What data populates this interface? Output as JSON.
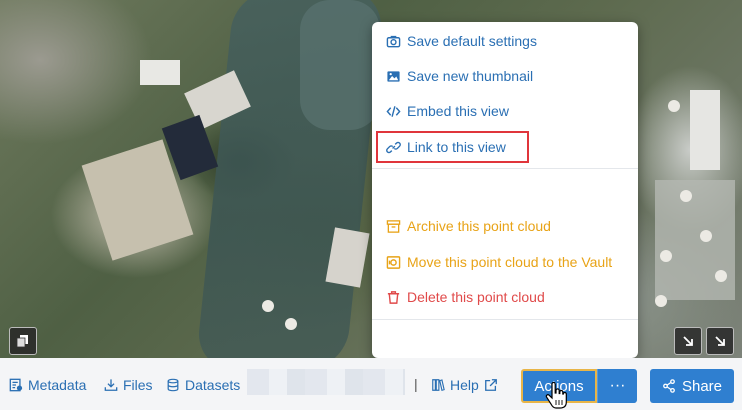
{
  "menu": {
    "items": [
      {
        "label": "Save default settings",
        "icon": "camera-icon",
        "color": "#2a6fb3"
      },
      {
        "label": "Save new thumbnail",
        "icon": "image-icon",
        "color": "#2a6fb3"
      },
      {
        "label": "Embed this view",
        "icon": "code-icon",
        "color": "#2a6fb3"
      },
      {
        "label": "Link to this view",
        "icon": "link-icon",
        "color": "#2a6fb3"
      },
      {
        "label": "Archive this point cloud",
        "icon": "archive-icon",
        "color": "#e8a317"
      },
      {
        "label": "Move this point cloud to the Vault",
        "icon": "vault-icon",
        "color": "#e8a317"
      },
      {
        "label": "Delete this point cloud",
        "icon": "trash-icon",
        "color": "#e04a4a"
      }
    ],
    "highlight_color": "#e0353b"
  },
  "bottom_bar": {
    "metadata": "Metadata",
    "files": "Files",
    "datasets": "Datasets",
    "separator": "|",
    "help": "Help",
    "actions": "Actions",
    "more": "···",
    "share": "Share"
  },
  "colors": {
    "primary": "#2f7fd0",
    "link": "#2a6fb3"
  }
}
